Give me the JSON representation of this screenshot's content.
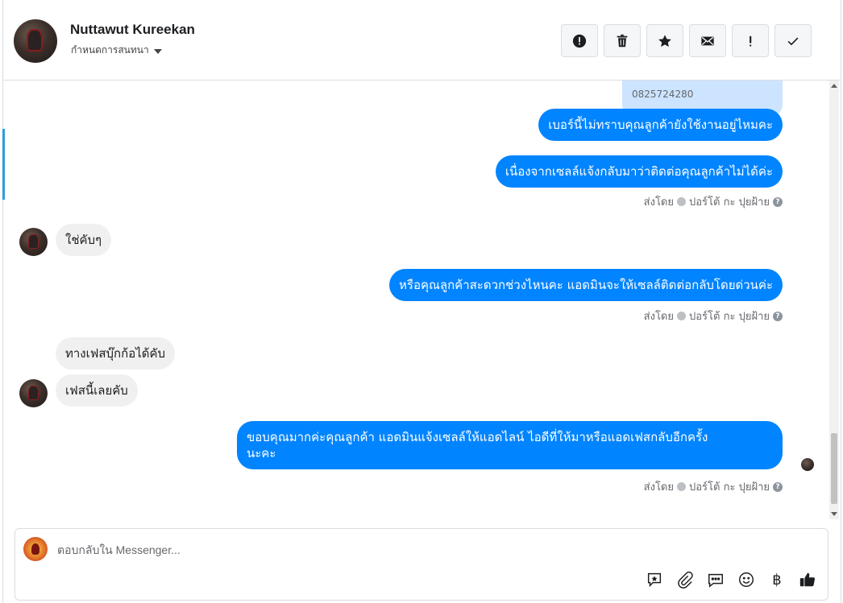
{
  "header": {
    "contact_name": "Nuttawut Kureekan",
    "assign_label": "กำหนดการสนทนา",
    "actions": [
      {
        "name": "spam-button",
        "icon": "alert-circle-icon"
      },
      {
        "name": "delete-button",
        "icon": "trash-icon"
      },
      {
        "name": "star-button",
        "icon": "star-icon"
      },
      {
        "name": "mark-unread-button",
        "icon": "envelope-icon"
      },
      {
        "name": "follow-up-button",
        "icon": "exclamation-icon"
      },
      {
        "name": "mark-done-button",
        "icon": "checkmark-icon"
      }
    ]
  },
  "thread": {
    "messages": [
      {
        "dir": "out",
        "text": "0825724280",
        "style": "faded"
      },
      {
        "dir": "out",
        "text": "เบอร์นี้ไม่ทราบคุณลูกค้ายังใช้งานอยู่ไหมคะ"
      },
      {
        "dir": "out",
        "text": "เนื่องจากเซลล์แจ้งกลับมาว่าติดต่อคุณลูกค้าไม่ได้ค่ะ"
      },
      {
        "dir": "in",
        "text": "ใช่คับๆ"
      },
      {
        "dir": "out",
        "text": "หรือคุณลูกค้าสะดวกช่วงไหนคะ แอดมินจะให้เซลล์ติดต่อกลับโดยด่วนค่ะ"
      },
      {
        "dir": "in",
        "text": "ทางเฟสบุ๊กก้อได้คับ"
      },
      {
        "dir": "in",
        "text": "เฟสนี้เลยคับ"
      },
      {
        "dir": "out",
        "text_line1": "ขอบคุณมากค่ะคุณลูกค้า แอดมินแจ้งเซลล์ให้แอดไลน์ ไอดีที่ให้มาหรือแอดเฟสกลับอีกครั้ง",
        "text_line2": "นะคะ"
      }
    ],
    "sent_by_prefix": "ส่งโดย",
    "sender_name": "ปอร์โต้ กะ ปุยฝ้าย"
  },
  "composer": {
    "placeholder": "ตอบกลับใน Messenger...",
    "tools": [
      "saved-reply-icon",
      "attachment-icon",
      "quick-reply-icon",
      "emoji-icon",
      "baht-icon",
      "like-icon"
    ],
    "baht_symbol": "฿"
  },
  "colors": {
    "outgoing_bubble": "#0084ff",
    "incoming_bubble": "#f0f0f0",
    "faded_bubble": "#cce4ff",
    "accent": "#2d9cdb"
  }
}
